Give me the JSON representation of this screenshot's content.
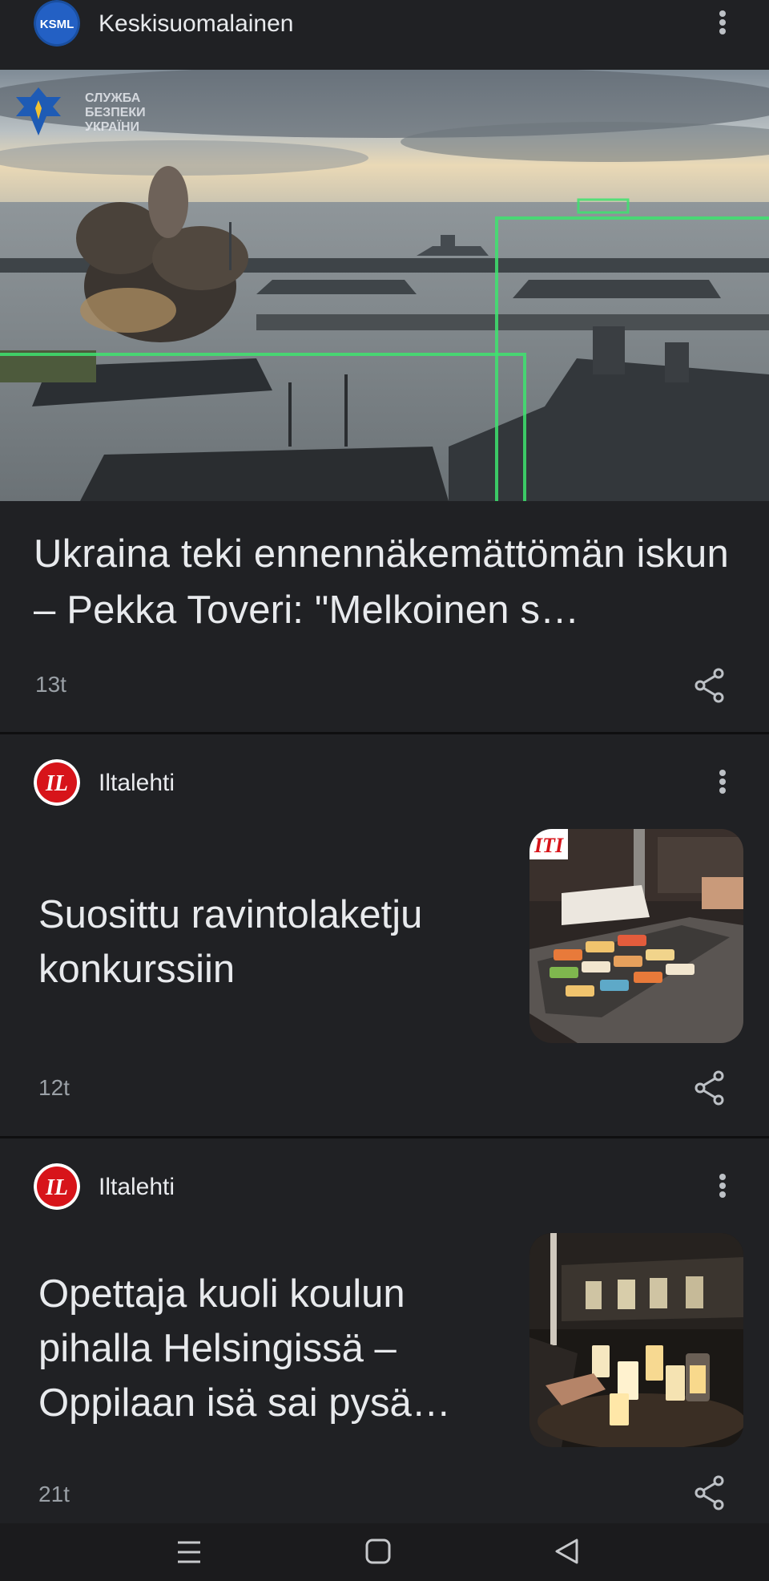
{
  "cards": [
    {
      "source": {
        "name": "Keskisuomalainen",
        "logo_text": "KSML"
      },
      "image_overlay_text": [
        "СЛУЖБА",
        "БЕЗПЕКИ",
        "УКРАЇНИ"
      ],
      "headline": "Ukraina teki ennennäkemättömän iskun – Pekka Toveri: \"Melkoinen s…",
      "time": "13t"
    },
    {
      "source": {
        "name": "Iltalehti",
        "logo_text": "IL"
      },
      "thumb_badge": "ITI",
      "headline": "Suosittu ravintolaketju konkurssiin",
      "time": "12t"
    },
    {
      "source": {
        "name": "Iltalehti",
        "logo_text": "IL"
      },
      "headline": "Opettaja kuoli koulun pihalla Helsingissä – Oppilaan isä sai pysä…",
      "time": "21t"
    }
  ],
  "colors": {
    "background": "#202124",
    "text": "#e8eaed",
    "muted": "#9aa0a6",
    "ksml_blue": "#1a4fa0",
    "iltalehti_red": "#d7141a"
  },
  "navbar": {
    "icons": [
      "recent-apps-icon",
      "home-icon",
      "back-icon"
    ]
  }
}
